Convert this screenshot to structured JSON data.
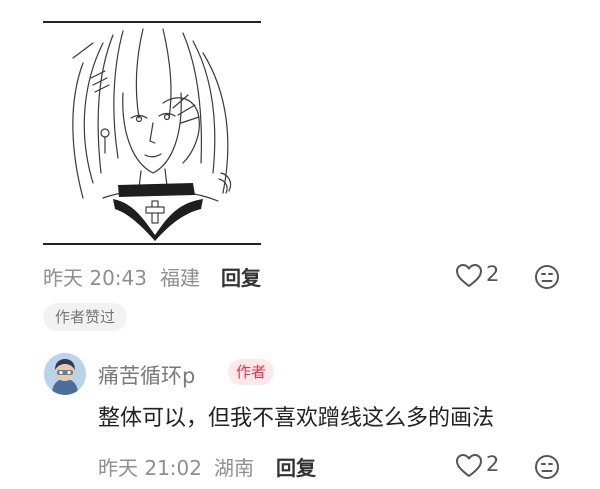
{
  "comment": {
    "time": "昨天 20:43",
    "location": "福建",
    "reply_label": "回复",
    "like_count": "2",
    "author_liked_tag": "作者赞过"
  },
  "reply": {
    "username": "痛苦循环p",
    "author_badge": "作者",
    "text": "整体可以，但我不喜欢蹭线这么多的画法",
    "time": "昨天 21:02",
    "location": "湖南",
    "reply_label": "回复",
    "like_count": "2"
  },
  "icons": {
    "like": "heart-outline-icon",
    "dislike": "unhappy-face-icon"
  },
  "colors": {
    "author_badge_text": "#e8344b",
    "author_badge_bg": "#fde8ea",
    "meta_gray": "#8f8f8f"
  }
}
